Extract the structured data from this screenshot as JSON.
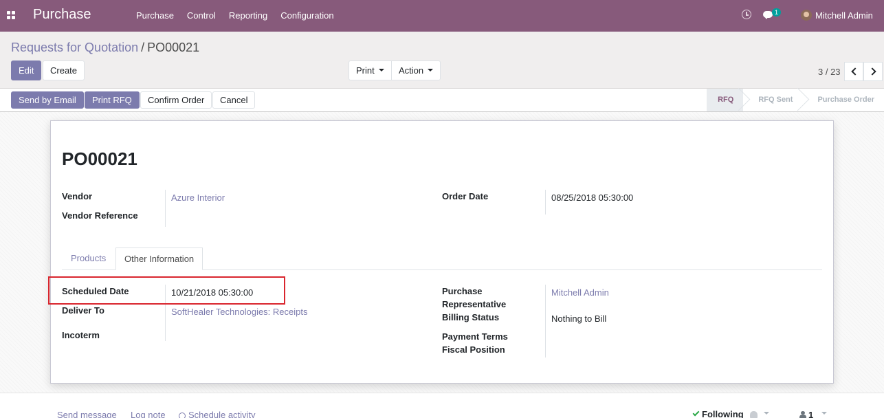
{
  "navbar": {
    "app_name": "Purchase",
    "menu": [
      "Purchase",
      "Control",
      "Reporting",
      "Configuration"
    ],
    "chat_count": "1",
    "user_name": "Mitchell Admin",
    "color": "#875a7b"
  },
  "breadcrumb": {
    "parent": "Requests for Quotation",
    "separator": "/",
    "current": "PO00021"
  },
  "buttons": {
    "edit": "Edit",
    "create": "Create",
    "print": "Print",
    "action": "Action"
  },
  "pager": {
    "value": "3 / 23"
  },
  "header_buttons": {
    "send_email": "Send by Email",
    "print_rfq": "Print RFQ",
    "confirm": "Confirm Order",
    "cancel": "Cancel"
  },
  "statusbar": {
    "stages": [
      "RFQ",
      "RFQ Sent",
      "Purchase Order"
    ],
    "active": "RFQ"
  },
  "form": {
    "title": "PO00021",
    "vendor_label": "Vendor",
    "vendor_value": "Azure Interior",
    "vendor_ref_label": "Vendor Reference",
    "order_date_label": "Order Date",
    "order_date_value": "08/25/2018 05:30:00",
    "tabs": [
      "Products",
      "Other Information"
    ],
    "active_tab": "Other Information",
    "scheduled_date_label": "Scheduled Date",
    "scheduled_date_value": "10/21/2018 05:30:00",
    "deliver_to_label": "Deliver To",
    "deliver_to_value": "SoftHealer Technologies: Receipts",
    "incoterm_label": "Incoterm",
    "purchase_rep_label_1": "Purchase",
    "purchase_rep_label_2": "Representative",
    "purchase_rep_value": "Mitchell Admin",
    "billing_status_label": "Billing Status",
    "billing_status_value": "Nothing to Bill",
    "payment_terms_label": "Payment Terms",
    "fiscal_position_label": "Fiscal Position"
  },
  "chatter": {
    "send_message": "Send message",
    "log_note": "Log note",
    "schedule_activity": "Schedule activity",
    "following": "Following",
    "followers": "1"
  },
  "colors": {
    "accent": "#7c7bad",
    "highlight": "#d9252d"
  }
}
